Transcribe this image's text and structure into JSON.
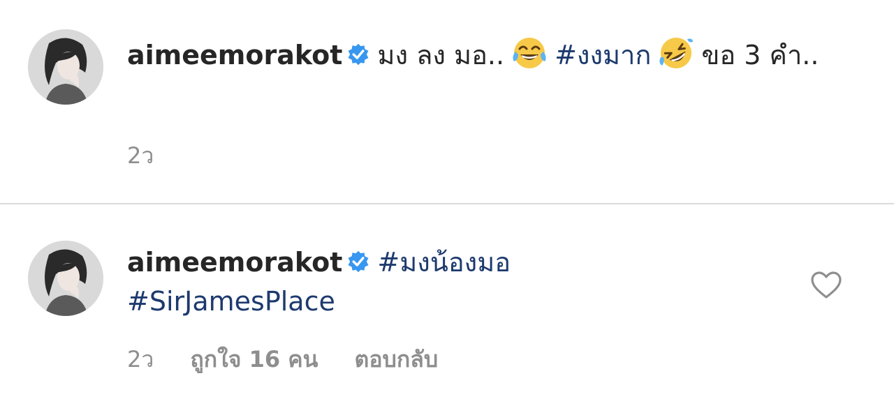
{
  "comments": [
    {
      "username": "aimeemorakot",
      "verified": true,
      "text_1": "มง ลง มอ..",
      "emoji_1": "face-with-tears-of-joy-icon",
      "hashtag": "#งงมาก",
      "emoji_2": "rolling-on-floor-laughing-icon",
      "text_2": "ขอ 3 คำ..",
      "time": "2ว"
    },
    {
      "username": "aimeemorakot",
      "verified": true,
      "hashtag_1": "#มงน้องมอ",
      "hashtag_2": "#SirJamesPlace",
      "time": "2ว",
      "likes": "ถูกใจ 16 คน",
      "reply": "ตอบกลับ"
    }
  ],
  "colors": {
    "text": "#262626",
    "hashtag": "#1d3a6e",
    "meta": "#8e8e8e",
    "verified": "#3897f0",
    "divider": "#dbdbdb"
  }
}
